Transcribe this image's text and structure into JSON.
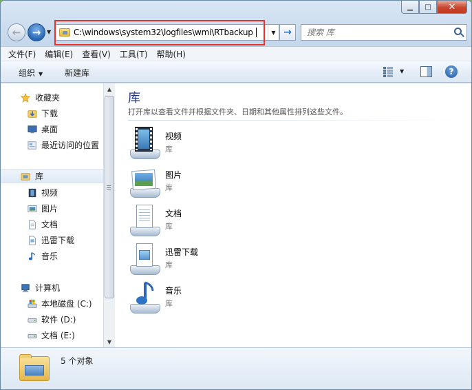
{
  "window": {
    "controls": {
      "minimize": "▁",
      "maximize": "□",
      "close": "✕"
    }
  },
  "address": {
    "back_glyph": "←",
    "forward_glyph": "→",
    "path": "C:\\windows\\system32\\logfiles\\wmi\\RTbackup",
    "go_glyph": "→",
    "dropdown_glyph": "▼"
  },
  "search": {
    "placeholder": "搜索 库"
  },
  "menu": [
    "文件(F)",
    "编辑(E)",
    "查看(V)",
    "工具(T)",
    "帮助(H)"
  ],
  "toolbar": {
    "organize": "组织",
    "new_library": "新建库",
    "help_glyph": "?"
  },
  "nav": {
    "favorites": {
      "header": "收藏夹",
      "items": [
        "下载",
        "桌面",
        "最近访问的位置"
      ]
    },
    "libraries": {
      "header": "库",
      "items": [
        "视频",
        "图片",
        "文档",
        "迅雷下载",
        "音乐"
      ]
    },
    "computer": {
      "header": "计算机",
      "items": [
        "本地磁盘 (C:)",
        "软件 (D:)",
        "文档 (E:)"
      ]
    }
  },
  "content": {
    "title": "库",
    "description": "打开库以查看文件并根据文件夹、日期和其他属性排列这些文件。",
    "items": [
      {
        "name": "视频",
        "type": "库",
        "icon": "video-library-icon"
      },
      {
        "name": "图片",
        "type": "库",
        "icon": "picture-library-icon"
      },
      {
        "name": "文档",
        "type": "库",
        "icon": "document-library-icon"
      },
      {
        "name": "迅雷下载",
        "type": "库",
        "icon": "download-library-icon"
      },
      {
        "name": "音乐",
        "type": "库",
        "icon": "music-library-icon"
      }
    ]
  },
  "status": {
    "count": "5 个对象"
  },
  "colors": {
    "highlight_box": "#e8312a",
    "title_blue": "#1e3287"
  }
}
